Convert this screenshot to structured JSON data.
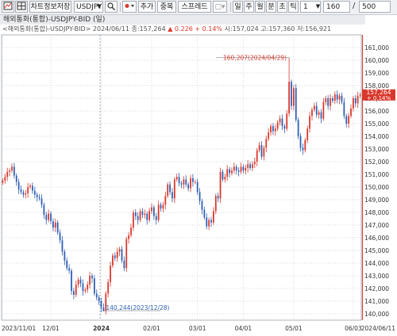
{
  "toolbar": {
    "save_label": "차트정보저장",
    "symbol": "USDJPY",
    "add_label": "추가",
    "overlap_label": "중복",
    "spread_label": "스프레드",
    "period_day": "일",
    "period_week": "주",
    "period_month": "월",
    "period_min": "분",
    "period_sec": "초",
    "period_tick": "틱",
    "interval_value": "1",
    "count_value": "160",
    "slash": "/",
    "total_value": "500"
  },
  "header": {
    "title": "해외통화(통합)-USDJPY-BID (일)",
    "info_prefix": "<해외통화(통합)-USDJPY-BID> 2024/06/11 종:157,264",
    "change": "▲ 0.226 + 0.14%",
    "ohlc": "시:157,024 고:157,360 저:156,921"
  },
  "colors": {
    "up": "#d9382c",
    "down": "#2f5fb3",
    "grid": "#c9ccd2",
    "price_tag": "#d9382c",
    "accent_line": "#e0443a"
  },
  "chart_data": {
    "type": "candlestick",
    "ylim": [
      139.5,
      162
    ],
    "yticks": [
      "161,000",
      "160,000",
      "159,000",
      "158,000",
      "157,000",
      "156,000",
      "155,000",
      "154,000",
      "153,000",
      "152,000",
      "151,000",
      "150,000",
      "149,000",
      "148,000",
      "147,000",
      "146,000",
      "145,000",
      "144,000",
      "143,000",
      "142,000",
      "141,000",
      "140,000"
    ],
    "xticks": [
      "2023/11/01",
      "12/01",
      "2024",
      "02/01",
      "03/01",
      "04/01",
      "05/01",
      "06/03",
      "2024/06/11"
    ],
    "last_price_label": "157,264",
    "last_change_label": "+ 0.14%",
    "last_close": 157.264,
    "annotations": [
      {
        "text": "160,207(2024/04/29)",
        "value": 160.207,
        "date": "2024/04/29"
      },
      {
        "text": "140,244(2023/12/28)",
        "value": 140.244,
        "date": "2023/12/28"
      }
    ],
    "closes": [
      150.5,
      150.8,
      151.2,
      151.3,
      151.6,
      150.9,
      150.4,
      149.8,
      149.6,
      149.4,
      149.5,
      150.0,
      150.1,
      149.7,
      149.4,
      149.2,
      149.1,
      148.6,
      147.8,
      147.4,
      147.9,
      147.3,
      146.8,
      147.2,
      146.4,
      145.8,
      144.9,
      144.2,
      143.6,
      143.4,
      141.8,
      141.5,
      142.3,
      142.7,
      142.4,
      141.8,
      141.9,
      142.3,
      143.0,
      142.8,
      141.6,
      141.3,
      141.0,
      140.5,
      140.2,
      141.6,
      142.5,
      143.8,
      144.6,
      144.4,
      144.9,
      145.1,
      144.2,
      143.6,
      145.9,
      146.2,
      146.8,
      148.0,
      147.7,
      147.4,
      148.1,
      147.8,
      147.9,
      147.4,
      148.1,
      148.4,
      147.7,
      147.4,
      148.6,
      148.3,
      148.6,
      149.3,
      150.2,
      149.6,
      149.1,
      150.6,
      150.8,
      150.3,
      150.2,
      150.6,
      150.2,
      149.9,
      150.7,
      150.4,
      150.4,
      149.6,
      148.9,
      148.2,
      147.6,
      146.9,
      147.4,
      147.2,
      148.1,
      149.3,
      149.1,
      151.2,
      150.6,
      150.8,
      151.4,
      151.1,
      151.3,
      151.6,
      151.3,
      151.2,
      151.6,
      151.3,
      151.5,
      151.8,
      151.5,
      151.8,
      152.0,
      152.9,
      153.3,
      152.4,
      153.1,
      153.8,
      154.3,
      154.8,
      154.4,
      154.6,
      155.1,
      155.4,
      154.8,
      154.6,
      155.8,
      158.3,
      156.4,
      157.8,
      155.3,
      154.0,
      153.1,
      152.9,
      153.7,
      154.6,
      155.6,
      156.1,
      156.4,
      155.7,
      155.9,
      155.4,
      156.7,
      157.0,
      156.4,
      157.0,
      156.8,
      157.3,
      156.9,
      157.2,
      156.7,
      155.6,
      155.0,
      155.6,
      156.2,
      157.0,
      156.6,
      157.2,
      157.264
    ],
    "extremes": [
      {
        "index": 125,
        "high": 160.207
      },
      {
        "index": 44,
        "low": 140.244
      }
    ]
  }
}
